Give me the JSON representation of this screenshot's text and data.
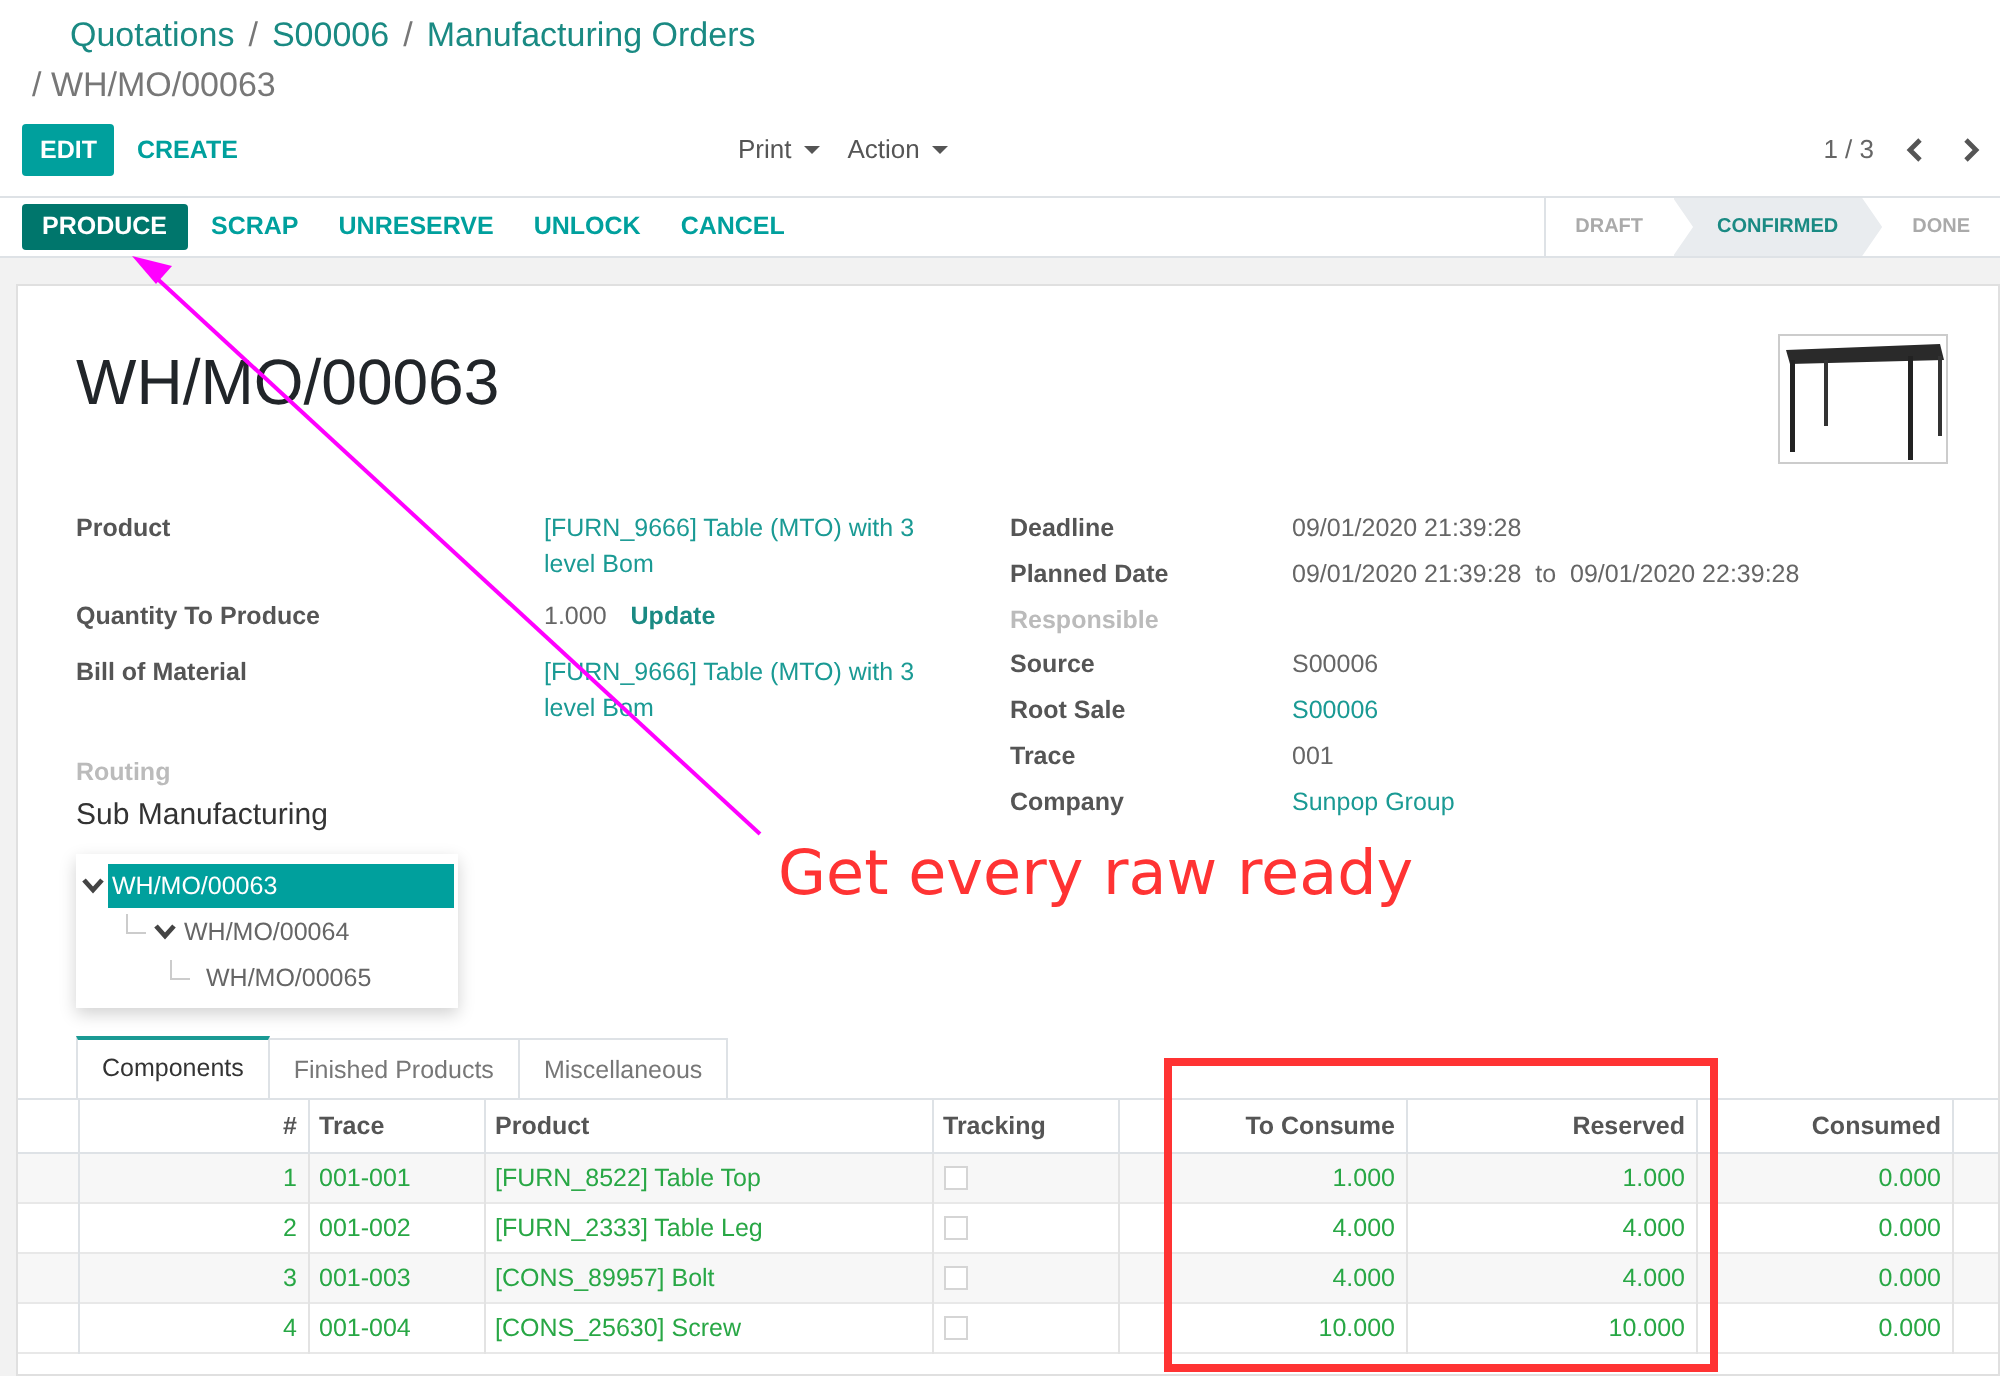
{
  "breadcrumb_separator": "/",
  "breadcrumbs": [
    {
      "label": "Quotations"
    },
    {
      "label": "S00006"
    },
    {
      "label": "Manufacturing Orders"
    }
  ],
  "current_record": "WH/MO/00063",
  "control_buttons": [
    {
      "label": "EDIT",
      "primary": true
    },
    {
      "label": "CREATE",
      "primary": false
    }
  ],
  "dropdowns": [
    {
      "label": "Print"
    },
    {
      "label": "Action"
    }
  ],
  "pager": {
    "text": "1 / 3"
  },
  "action_buttons": [
    {
      "label": "PRODUCE",
      "primary": true
    },
    {
      "label": "SCRAP",
      "primary": false
    },
    {
      "label": "UNRESERVE",
      "primary": false
    },
    {
      "label": "UNLOCK",
      "primary": false
    },
    {
      "label": "CANCEL",
      "primary": false
    }
  ],
  "stages": [
    {
      "label": "DRAFT",
      "selected": false
    },
    {
      "label": "CONFIRMED",
      "selected": true
    },
    {
      "label": "DONE",
      "selected": false
    }
  ],
  "title": "WH/MO/00063",
  "left_fields": [
    {
      "label": "Product",
      "value": "[FURN_9666] Table (MTO) with 3 level Bom",
      "link": true
    },
    {
      "label": "Quantity To Produce",
      "value": "1.000",
      "link": false,
      "button": "Update"
    },
    {
      "label": "Bill of Material",
      "value": "[FURN_9666] Table (MTO) with 3 level Bom",
      "link": true
    }
  ],
  "routing": {
    "label": "Routing",
    "value": "Sub Manufacturing"
  },
  "tree": [
    {
      "label": "WH/MO/00063",
      "selected": true,
      "expanded": true,
      "children": [
        {
          "label": "WH/MO/00064",
          "selected": false,
          "expanded": true,
          "children": [
            {
              "label": "WH/MO/00065",
              "selected": false
            }
          ]
        }
      ]
    }
  ],
  "right_fields": [
    {
      "label": "Deadline",
      "value": "09/01/2020 21:39:28",
      "link": false,
      "empty": false
    },
    {
      "label": "Planned Date",
      "value": "09/01/2020 21:39:28  to  09/01/2020 22:39:28",
      "link": false,
      "empty": false
    },
    {
      "label": "Responsible",
      "empty": true
    },
    {
      "label": "Source",
      "value": "S00006",
      "link": false,
      "empty": false
    },
    {
      "label": "Root Sale",
      "value": "S00006",
      "link": true,
      "empty": false
    },
    {
      "label": "Trace",
      "value": "001",
      "link": false,
      "empty": false
    },
    {
      "label": "Company",
      "value": "Sunpop Group",
      "link": true,
      "empty": false
    }
  ],
  "tabs": [
    {
      "label": "Components",
      "selected": true
    },
    {
      "label": "Finished Products",
      "selected": false
    },
    {
      "label": "Miscellaneous",
      "selected": false
    }
  ],
  "table": {
    "columns": [
      "#",
      "Trace",
      "Product",
      "Tracking",
      "To Consume",
      "Reserved",
      "Consumed"
    ],
    "rows": [
      {
        "number": "1",
        "trace": "001-001",
        "product": "[FURN_8522] Table Top",
        "tracked": false,
        "to_consume": "1.000",
        "reserved": "1.000",
        "consumed": "0.000"
      },
      {
        "number": "2",
        "trace": "001-002",
        "product": "[FURN_2333] Table Leg",
        "tracked": false,
        "to_consume": "4.000",
        "reserved": "4.000",
        "consumed": "0.000"
      },
      {
        "number": "3",
        "trace": "001-003",
        "product": "[CONS_89957] Bolt",
        "tracked": false,
        "to_consume": "4.000",
        "reserved": "4.000",
        "consumed": "0.000"
      },
      {
        "number": "4",
        "trace": "001-004",
        "product": "[CONS_25630] Screw",
        "tracked": false,
        "to_consume": "10.000",
        "reserved": "10.000",
        "consumed": "0.000"
      }
    ]
  },
  "annotation": {
    "text": "Get every raw ready"
  }
}
